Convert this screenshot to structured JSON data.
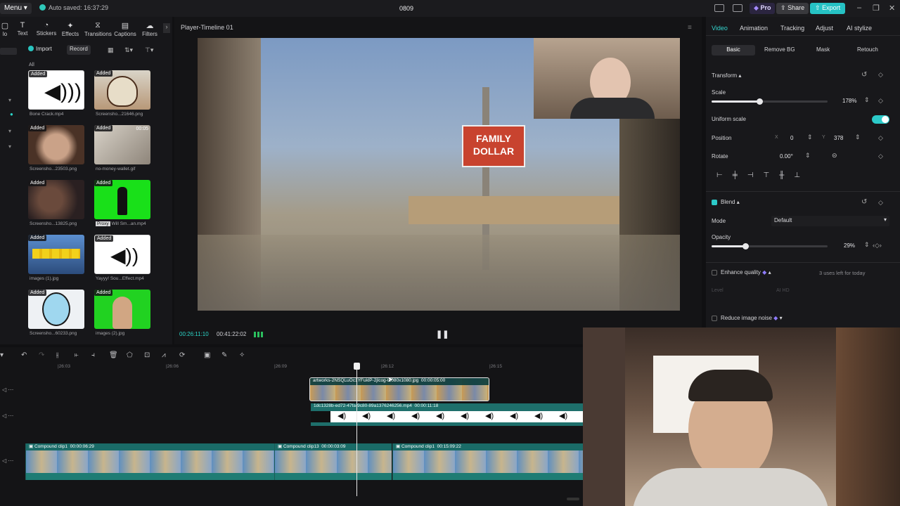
{
  "titlebar": {
    "menu_label": "Menu",
    "autosave": "Auto saved: 16:37:29",
    "project_name": "0809",
    "pro_label": "Pro",
    "share_label": "Share",
    "export_label": "Export"
  },
  "toolbar": {
    "items": [
      {
        "label": "lo",
        "icon": "media-icon"
      },
      {
        "label": "Text",
        "icon": "text-icon"
      },
      {
        "label": "Stickers",
        "icon": "sticker-icon"
      },
      {
        "label": "Effects",
        "icon": "effects-icon"
      },
      {
        "label": "Transitions",
        "icon": "transitions-icon"
      },
      {
        "label": "Captions",
        "icon": "captions-icon"
      },
      {
        "label": "Filters",
        "icon": "filters-icon"
      }
    ]
  },
  "media": {
    "import_label": "Import",
    "record_label": "Record",
    "all_label": "All",
    "added_badge": "Added",
    "proxy_badge": "Proxy",
    "items": [
      {
        "name": "Bone Crack.mp4"
      },
      {
        "name": "Screensho...21646.png"
      },
      {
        "name": "Screensho...23503.png"
      },
      {
        "name": "no-money-wallet.gif"
      },
      {
        "name": "Screensho...13825.png"
      },
      {
        "name": "Will Sm...an.mp4"
      },
      {
        "name": "images (1).jpg"
      },
      {
        "name": "Yayyy! Sou...Effect.mp4"
      },
      {
        "name": "Screensho...60233.png"
      },
      {
        "name": "images (2).jpg"
      }
    ],
    "thumb_timecode": "00:05"
  },
  "player": {
    "title": "Player-Timeline 01",
    "current_time": "00:26:11:10",
    "total_time": "00:41:22:02",
    "sign_line1": "FAMILY",
    "sign_line2": "DOLLAR"
  },
  "inspector": {
    "tabs": [
      "Video",
      "Animation",
      "Tracking",
      "Adjust",
      "AI stylize"
    ],
    "subtabs": [
      "Basic",
      "Remove BG",
      "Mask",
      "Retouch"
    ],
    "transform_label": "Transform",
    "scale_label": "Scale",
    "scale_value": "178%",
    "scale_fraction": 0.41,
    "uniform_scale_label": "Uniform scale",
    "position_label": "Position",
    "pos_x_label": "X",
    "pos_x": "0",
    "pos_y_label": "Y",
    "pos_y": "378",
    "rotate_label": "Rotate",
    "rotate_value": "0.00°",
    "blend_label": "Blend",
    "mode_label": "Mode",
    "mode_value": "Default",
    "opacity_label": "Opacity",
    "opacity_value": "29%",
    "opacity_fraction": 0.29,
    "enhance_label": "Enhance quality",
    "enhance_note": "3 uses left for today",
    "level_label": "Level",
    "level_value": "AI HD",
    "noise_label": "Reduce image noise",
    "accent_color": "#2ccac9"
  },
  "timeline": {
    "ruler": [
      "|26:03",
      "|26:06",
      "|26:09",
      "|26:12",
      "|26:15"
    ],
    "clips": {
      "image_clip": {
        "name": "artworks-2NSQLuOc1YFuklP-2jlcog-t1080x1080.jpg",
        "duration": "00:00:05:00"
      },
      "audio_clip": {
        "name": "1dc1328b-ed72-47fa-9c80-89a1376246256.mp4",
        "duration": "00:00:11:18"
      },
      "compound": [
        {
          "name": "Compound clip1",
          "duration": "00:00:06:29"
        },
        {
          "name": "Compound clip13",
          "duration": "00:00:03:09"
        },
        {
          "name": "Compound clip1",
          "duration": "00:15:09:22"
        }
      ]
    }
  }
}
